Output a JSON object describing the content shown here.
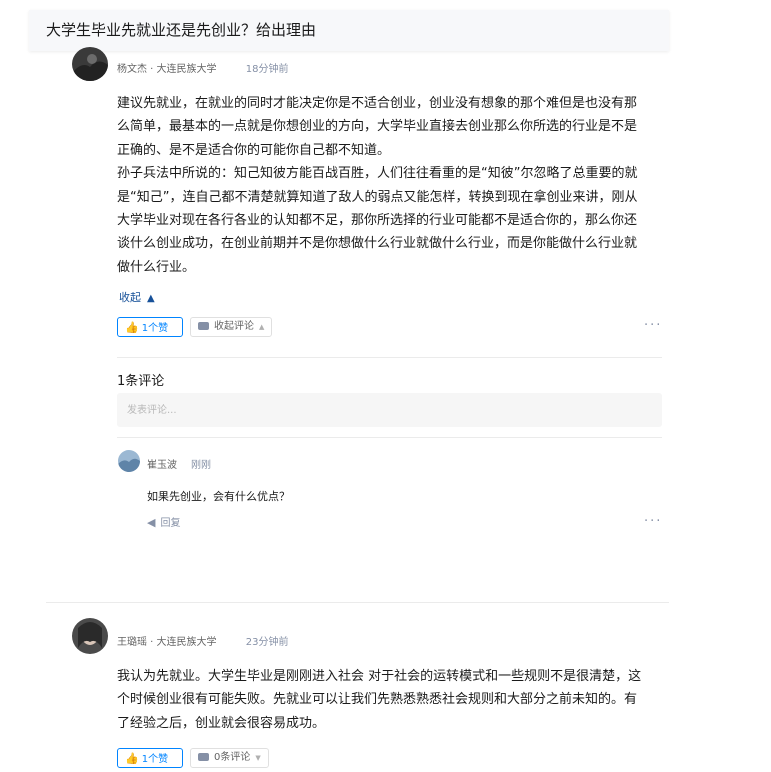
{
  "question": {
    "title": "大学生毕业先就业还是先创业？给出理由"
  },
  "answers": [
    {
      "author": "杨文杰",
      "school": "大连民族大学",
      "time": "18分钟前",
      "paragraphs": [
        [
          "建议先就业，在就业的同时才能决定你是不适合创业，创业没有想象的那个难但是也没有那",
          "么简单，最基本的一点就是你想创业的方向，大学毕业直接去创业那么你所选的行业是不是",
          "正确的、是不是适合你的可能你自己都不知道。"
        ],
        [
          "孙子兵法中所说的：知己知彼方能百战百胜，人们往往看重的是“知彼”尔忽略了总重要的就",
          "是“知己”，连自己都不清楚就算知道了敌人的弱点又能怎样，转换到现在拿创业来讲，刚从",
          "大学毕业对现在各行各业的认知都不足，那你所选择的行业可能都不是适合你的，那么你还",
          "谈什么创业成功，在创业前期并不是你想做什么行业就做什么行业，而是你能做什么行业就",
          "做什么行业。"
        ]
      ],
      "collapse_label": "收起",
      "vote_label": "1个赞",
      "comment_toggle_label": "收起评论",
      "comments_count_label": "1条评论",
      "comment_placeholder": "发表评论...",
      "comments": [
        {
          "author": "崔玉波",
          "time": "刚刚",
          "text": "如果先创业，会有什么优点？",
          "reply_label": "回复"
        }
      ]
    },
    {
      "author": "王璐瑶",
      "school": "大连民族大学",
      "time": "23分钟前",
      "paragraphs": [
        [
          "我认为先就业。大学生毕业是刚刚进入社会 对于社会的运转模式和一些规则不是很清楚，这",
          "个时候创业很有可能失败。先就业可以让我们先熟悉熟悉社会规则和大部分之前未知的。有",
          "了经验之后，创业就会很容易成功。"
        ]
      ],
      "vote_label": "1个赞",
      "comment_toggle_label": "0条评论"
    }
  ],
  "more_label": "···",
  "meta_sep": " · ",
  "colors": {
    "accent": "#0084ff",
    "link": "#175199",
    "muted": "#8590a6",
    "header_bg": "#f7f8fa"
  }
}
